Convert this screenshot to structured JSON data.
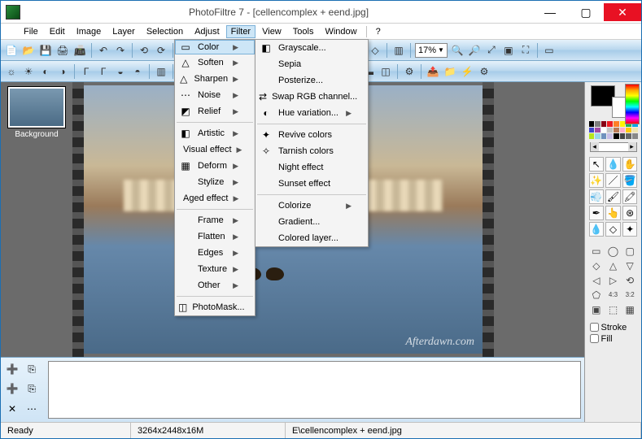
{
  "title": "PhotoFiltre 7 - [cellencomplex + eend.jpg]",
  "window_buttons": {
    "min": "—",
    "max": "▢",
    "close": "✕"
  },
  "menubar": [
    "File",
    "Edit",
    "Image",
    "Layer",
    "Selection",
    "Adjust",
    "Filter",
    "View",
    "Tools",
    "Window",
    "?"
  ],
  "menubar_active_index": 6,
  "zoom": "17%",
  "layer_thumb_label": "Background",
  "watermark": "Afterdawn.com",
  "status": {
    "ready": "Ready",
    "dims": "3264x2448x16M",
    "path": "E\\cellencomplex + eend.jpg"
  },
  "filter_menu": [
    {
      "label": "Color",
      "icon": "▭",
      "sub": true,
      "hl": true
    },
    {
      "label": "Soften",
      "icon": "△",
      "sub": true
    },
    {
      "label": "Sharpen",
      "icon": "△",
      "sub": true
    },
    {
      "label": "Noise",
      "icon": "⋯",
      "sub": true
    },
    {
      "label": "Relief",
      "icon": "◩",
      "sub": true
    },
    {
      "sep": true
    },
    {
      "label": "Artistic",
      "icon": "◧",
      "sub": true
    },
    {
      "label": "Visual effect",
      "icon": "",
      "sub": true
    },
    {
      "label": "Deform",
      "icon": "▦",
      "sub": true
    },
    {
      "label": "Stylize",
      "icon": "",
      "sub": true
    },
    {
      "label": "Aged effect",
      "icon": "",
      "sub": true
    },
    {
      "sep": true
    },
    {
      "label": "Frame",
      "icon": "",
      "sub": true
    },
    {
      "label": "Flatten",
      "icon": "",
      "sub": true
    },
    {
      "label": "Edges",
      "icon": "",
      "sub": true
    },
    {
      "label": "Texture",
      "icon": "",
      "sub": true
    },
    {
      "label": "Other",
      "icon": "",
      "sub": true
    },
    {
      "sep": true
    },
    {
      "label": "PhotoMask...",
      "icon": "◫"
    }
  ],
  "color_submenu": [
    {
      "label": "Grayscale...",
      "icon": "◧"
    },
    {
      "label": "Sepia",
      "icon": ""
    },
    {
      "label": "Posterize...",
      "icon": ""
    },
    {
      "label": "Swap RGB channel...",
      "icon": "⇄"
    },
    {
      "label": "Hue variation...",
      "icon": "◐",
      "sub": true
    },
    {
      "sep": true
    },
    {
      "label": "Revive colors",
      "icon": "✦"
    },
    {
      "label": "Tarnish colors",
      "icon": "✧"
    },
    {
      "label": "Night effect",
      "icon": ""
    },
    {
      "label": "Sunset effect",
      "icon": ""
    },
    {
      "sep": true
    },
    {
      "label": "Colorize",
      "icon": "",
      "sub": true
    },
    {
      "label": "Gradient...",
      "icon": ""
    },
    {
      "label": "Colored layer...",
      "icon": ""
    }
  ],
  "swatches": [
    "#000",
    "#7f7f7f",
    "#880015",
    "#ed1c24",
    "#ff7f27",
    "#fff200",
    "#22b14c",
    "#00a2e8",
    "#3f48cc",
    "#a349a4",
    "#fff",
    "#c3c3c3",
    "#b97a57",
    "#ffaec9",
    "#ffc90e",
    "#efe4b0",
    "#b5e61d",
    "#99d9ea",
    "#7092be",
    "#c8bfe7",
    "#000",
    "#444",
    "#666",
    "#888"
  ],
  "right_options": {
    "stroke": "Stroke",
    "fill": "Fill"
  }
}
